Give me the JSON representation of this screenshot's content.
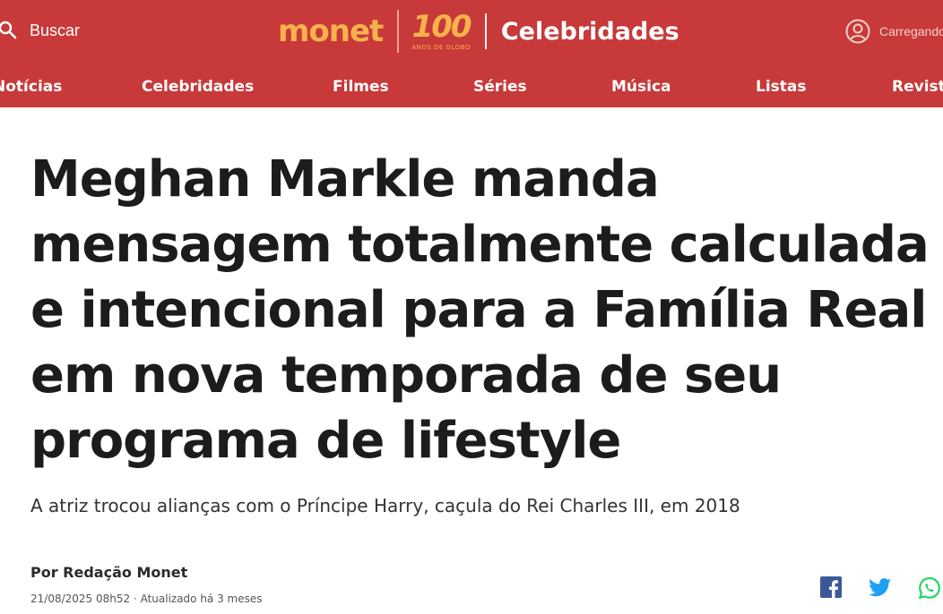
{
  "header": {
    "search_label": "Buscar",
    "logo_text": "monet",
    "seal_number": "100",
    "seal_text": "ANOS DE GLOBO",
    "section_title": "Celebridades",
    "account_label": "Carregando"
  },
  "nav": {
    "items": [
      {
        "label": "Notícias"
      },
      {
        "label": "Celebridades"
      },
      {
        "label": "Filmes"
      },
      {
        "label": "Séries"
      },
      {
        "label": "Música"
      },
      {
        "label": "Listas"
      },
      {
        "label": "Revista"
      }
    ]
  },
  "article": {
    "headline": "Meghan Markle manda mensagem totalmente calculada e intencional para a Família Real em nova temporada de seu programa de lifestyle",
    "subtitle": "A atriz trocou alianças com o Príncipe Harry, caçula do Rei Charles III, em 2018",
    "author": "Por Redação Monet",
    "date": "21/08/2025 08h52 · Atualizado há 3 meses"
  },
  "share": {
    "icons": [
      "facebook-icon",
      "twitter-icon",
      "whatsapp-icon"
    ]
  },
  "colors": {
    "header_bg": "#c8393a",
    "logo_orange": "#f7b24c",
    "facebook": "#3b5998",
    "twitter": "#1da1f2",
    "whatsapp": "#25d366",
    "text": "#1c1c1c"
  }
}
